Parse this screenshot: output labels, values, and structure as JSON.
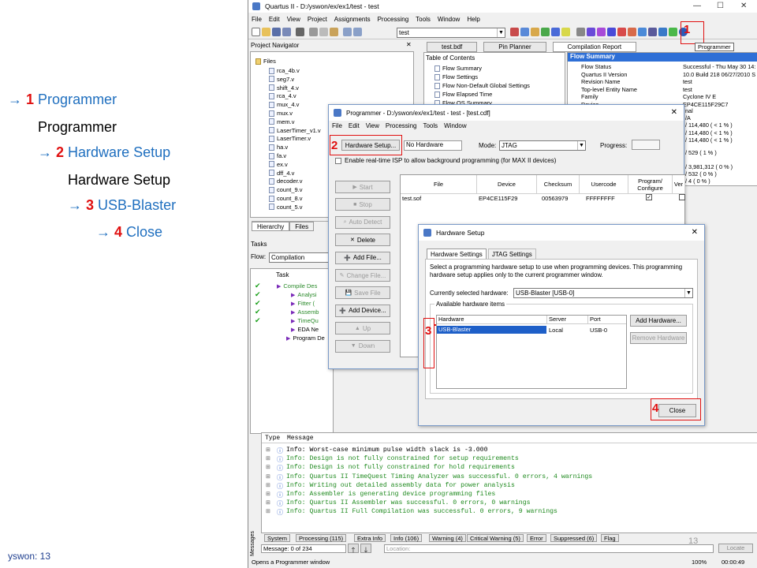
{
  "slide": {
    "steps": [
      {
        "arrow": "→",
        "num": "1",
        "label": "Programmer"
      },
      {
        "plain": "Programmer"
      },
      {
        "arrow": "→",
        "num": "2",
        "label": "Hardware Setup"
      },
      {
        "plain": "Hardware Setup"
      },
      {
        "arrow": "→",
        "num": "3",
        "label": "USB-Blaster"
      },
      {
        "arrow": "→",
        "num": "4",
        "label": "Close"
      }
    ],
    "footer": "yswon: 13",
    "page_number": "13"
  },
  "app": {
    "title": "Quartus II - D:/yswon/ex/ex1/test - test",
    "menu": [
      "File",
      "Edit",
      "View",
      "Project",
      "Assignments",
      "Processing",
      "Tools",
      "Window",
      "Help"
    ],
    "project_combo": "test",
    "tooltip": "Programmer",
    "callout_1": "1"
  },
  "navigator": {
    "title": "Project Navigator",
    "root": "Files",
    "files": [
      "rca_4b.v",
      "seg7.v",
      "shift_4.v",
      "rca_4.v",
      "mux_4.v",
      "mux.v",
      "mem.v",
      "LaserTimer_v1.v",
      "LaserTimer.v",
      "ha.v",
      "fa.v",
      "ex.v",
      "dff_4.v",
      "decoder.v",
      "count_9.v",
      "count_8.v",
      "count_5.v"
    ],
    "tabs": [
      "Hierarchy",
      "Files"
    ]
  },
  "tasks": {
    "title": "Tasks",
    "flow_label": "Flow:",
    "flow_value": "Compilation",
    "col_task": "Task",
    "items": [
      "Compile Des",
      "Analysi",
      "Fitter (",
      "Assemb",
      "TimeQu",
      "EDA Ne",
      "Program De"
    ]
  },
  "doc_tabs": [
    "test.bdf",
    "Pin Planner",
    "Compilation Report"
  ],
  "toc": {
    "title": "Table of Contents",
    "items": [
      "Flow Summary",
      "Flow Settings",
      "Flow Non-Default Global Settings",
      "Flow Elapsed Time",
      "Flow OS Summary"
    ]
  },
  "flow_summary": {
    "title": "Flow Summary",
    "rows": [
      {
        "k": "Flow Status",
        "v": "Successful - Thu May 30 14:"
      },
      {
        "k": "Quartus II Version",
        "v": "10.0 Build 218 06/27/2010 S"
      },
      {
        "k": "Revision Name",
        "v": "test"
      },
      {
        "k": "Top-level Entity Name",
        "v": "test"
      },
      {
        "k": "Family",
        "v": "Cyclone IV E"
      },
      {
        "k": "Device",
        "v": "EP4CE115F29C7"
      }
    ],
    "more": [
      "nal",
      "/A",
      "/ 114,480 ( < 1 % )",
      "/ 114,480 ( < 1 % )",
      "/ 114,480 ( < 1 % )",
      "/ 529 ( 1 % )",
      "/ 3,981,312 ( 0 % )",
      "/ 532 ( 0 % )",
      "/ 4 ( 0 % )"
    ]
  },
  "programmer": {
    "title": "Programmer - D:/yswon/ex/ex1/test - test - [test.cdf]",
    "menu": [
      "File",
      "Edit",
      "View",
      "Processing",
      "Tools",
      "Window"
    ],
    "hw_button": "Hardware Setup...",
    "hw_value": "No Hardware",
    "mode_label": "Mode:",
    "mode_value": "JTAG",
    "progress_label": "Progress:",
    "isp_text": "Enable real-time ISP to allow background programming (for MAX II devices)",
    "buttons": [
      "Start",
      "Stop",
      "Auto Detect",
      "Delete",
      "Add File...",
      "Change File...",
      "Save File",
      "Add Device...",
      "Up",
      "Down"
    ],
    "columns": [
      "File",
      "Device",
      "Checksum",
      "Usercode",
      "Program/\nConfigure",
      "Ver"
    ],
    "row": {
      "file": "test.sof",
      "device": "EP4CE115F29",
      "checksum": "00563979",
      "usercode": "FFFFFFFF"
    },
    "callout_2": "2"
  },
  "hw_setup": {
    "title": "Hardware Setup",
    "tabs": [
      "Hardware Settings",
      "JTAG Settings"
    ],
    "desc": "Select a programming hardware setup to use when programming devices. This programming hardware setup applies only to the current programmer window.",
    "current_label": "Currently selected hardware:",
    "current_value": "USB-Blaster [USB-0]",
    "group": "Available hardware items",
    "cols": [
      "Hardware",
      "Server",
      "Port"
    ],
    "row": {
      "hw": "USB-Blaster",
      "server": "Local",
      "port": "USB-0"
    },
    "add_btn": "Add Hardware...",
    "remove_btn": "Remove Hardware",
    "close_btn": "Close",
    "callout_3": "3",
    "callout_4": "4"
  },
  "messages": {
    "col_type": "Type",
    "col_msg": "Message",
    "lines": [
      "Info: Worst-case minimum pulse width slack is -3.000",
      "Info: Design is not fully constrained for setup requirements",
      "Info: Design is not fully constrained for hold requirements",
      "Info: Quartus II TimeQuest Timing Analyzer was successful. 0 errors, 4 warnings",
      "Info: Writing out detailed assembly data for power analysis",
      "Info: Assembler is generating device programming files",
      "Info: Quartus II Assembler was successful. 0 errors, 0 warnings",
      "Info: Quartus II Full Compilation was successful. 0 errors, 9 warnings"
    ],
    "tabs": [
      "System",
      "Processing (115)",
      "Extra Info",
      "Info (106)",
      "Warning (4)",
      "Critical Warning (5)",
      "Error",
      "Suppressed (6)",
      "Flag"
    ],
    "count": "Message: 0 of 234",
    "location_placeholder": "Location:",
    "locate_btn": "Locate",
    "side_label": "Messages"
  },
  "statusbar": {
    "left": "Opens a Programmer window",
    "zoom": "100%",
    "time": "00:00:49"
  }
}
